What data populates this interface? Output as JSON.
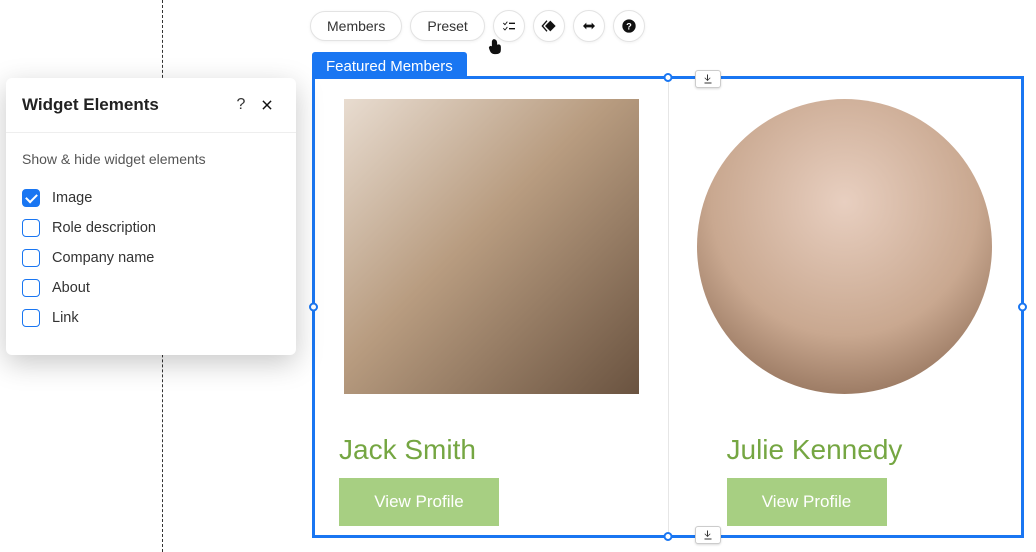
{
  "toolbar": {
    "members_label": "Members",
    "preset_label": "Preset"
  },
  "selection": {
    "label": "Featured Members"
  },
  "members": [
    {
      "name": "Jack Smith",
      "button_label": "View Profile"
    },
    {
      "name": "Julie Kennedy",
      "button_label": "View Profile"
    }
  ],
  "panel": {
    "title": "Widget Elements",
    "subtitle": "Show & hide widget elements",
    "options": [
      {
        "label": "Image",
        "checked": true
      },
      {
        "label": "Role description",
        "checked": false
      },
      {
        "label": "Company name",
        "checked": false
      },
      {
        "label": "About",
        "checked": false
      },
      {
        "label": "Link",
        "checked": false
      }
    ]
  }
}
